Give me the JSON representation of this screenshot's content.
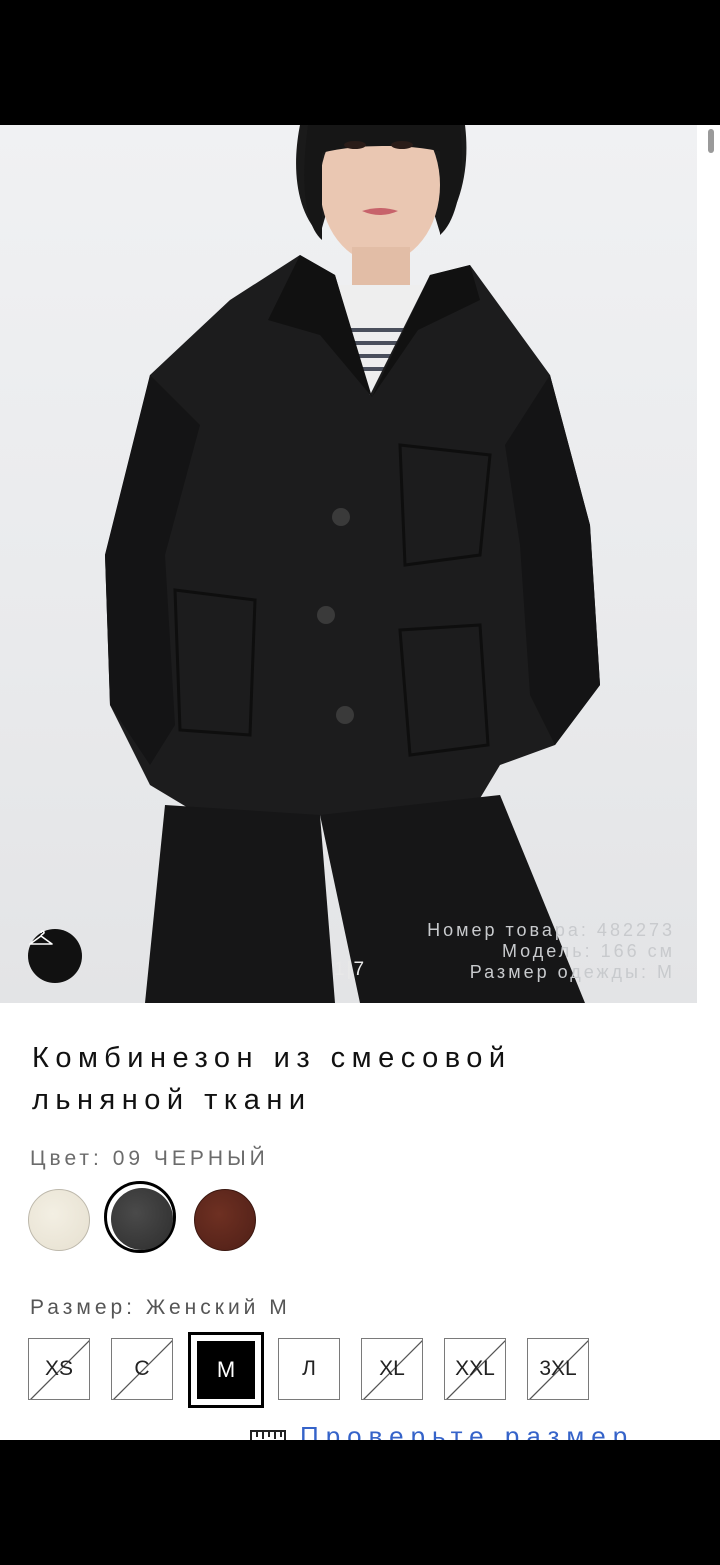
{
  "product": {
    "title": "Комбинезон из смесовой льняной ткани",
    "image_counter": "1|7",
    "meta": {
      "item_number": "Номер товара: 482273",
      "model_height": "Модель: 166 см",
      "garment_size": "Размер одежды: M"
    }
  },
  "color": {
    "label": "Цвет: 09 ЧЕРНЫЙ",
    "swatches": [
      {
        "name": "cream",
        "hex": "#ECE6D7"
      },
      {
        "name": "black",
        "hex": "#353535",
        "selected": true
      },
      {
        "name": "brown",
        "hex": "#5E271C"
      }
    ]
  },
  "size": {
    "label": "Размер: Женский M",
    "options": [
      {
        "label": "XS",
        "available": false
      },
      {
        "label": "С",
        "available": false
      },
      {
        "label": "M",
        "available": true,
        "selected": true
      },
      {
        "label": "Л",
        "available": true
      },
      {
        "label": "XL",
        "available": false
      },
      {
        "label": "XXL",
        "available": false
      },
      {
        "label": "3XL",
        "available": false
      }
    ],
    "check_link": "Проверьте размер"
  },
  "icons": {
    "hanger": "hanger-icon",
    "ruler": "ruler-icon"
  }
}
